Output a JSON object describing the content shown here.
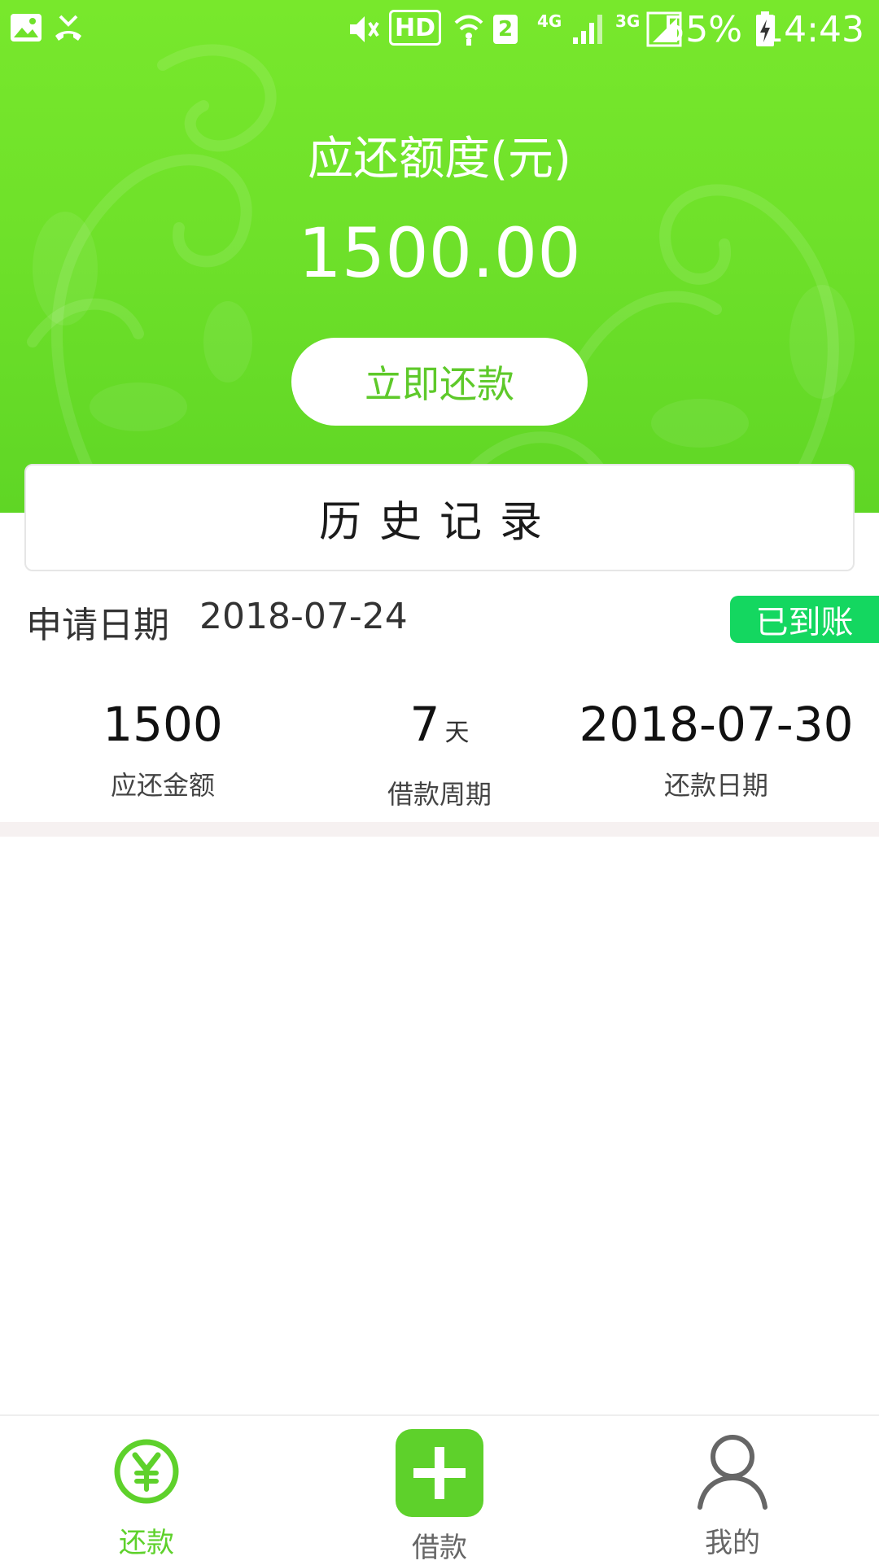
{
  "status_bar": {
    "hd": "HD",
    "sim": "2",
    "net_4g": "4G",
    "net_3g": "3G",
    "battery": "55%",
    "time": "14:43"
  },
  "balance": {
    "title": "应还额度(元)",
    "amount": "1500.00",
    "repay_button": "立即还款"
  },
  "history": {
    "title": "历史记录"
  },
  "record": {
    "apply_date_label": "申请日期",
    "apply_date": "2018-07-24",
    "status": "已到账",
    "stats": [
      {
        "value": "1500",
        "unit": "",
        "label": "应还金额"
      },
      {
        "value": "7",
        "unit": "天",
        "label": "借款周期"
      },
      {
        "value": "2018-07-30",
        "unit": "",
        "label": "还款日期"
      }
    ]
  },
  "nav": {
    "repay": "还款",
    "borrow": "借款",
    "mine": "我的"
  },
  "colors": {
    "brand_green": "#6fe12a",
    "accent_green": "#5ed12b",
    "status_green": "#14d760"
  }
}
